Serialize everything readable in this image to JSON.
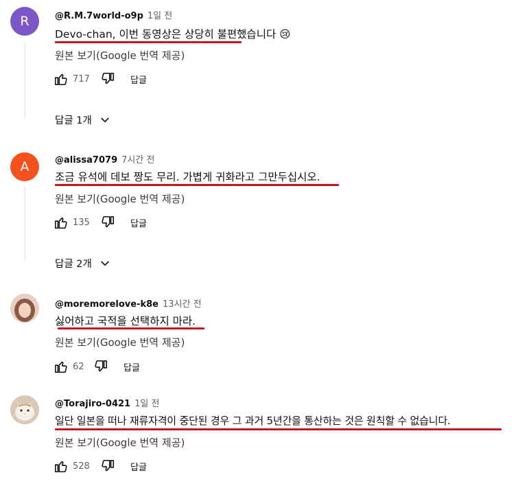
{
  "comments": [
    {
      "avatar_letter": "R",
      "avatar_color": "#7b57c8",
      "handle": "@R.M.7world-o9p",
      "time": "1일 전",
      "text": "Devo-chan, 이번 동영상은 상당히 불편했습니다 😢",
      "translate": "원본 보기(Google 번역 제공)",
      "likes": "717",
      "reply_label": "답글",
      "replies_toggle": "답글 1개"
    },
    {
      "avatar_letter": "A",
      "avatar_color": "#f4511e",
      "handle": "@alissa7079",
      "time": "7시간 전",
      "text": "조금 유석에 데보 짱도 무리. 가볍게 귀화라고 그만두십시오.",
      "translate": "원본 보기(Google 번역 제공)",
      "likes": "135",
      "reply_label": "답글",
      "replies_toggle": "답글 2개"
    },
    {
      "avatar_color": "#d9b8ad",
      "handle": "@moremorelove-k8e",
      "time": "13시간 전",
      "text": "싫어하고 국적을 선택하지 마라.",
      "translate": "원본 보기(Google 번역 제공)",
      "likes": "62",
      "reply_label": "답글"
    },
    {
      "avatar_color": "#c9b49a",
      "handle": "@Torajiro-0421",
      "time": "1일 전",
      "text": "일단 일본을 떠나 재류자격이 중단된 경우 그 과거 5년간을 통산하는 것은 원칙할 수 없습니다.",
      "translate": "원본 보기(Google 번역 제공)",
      "likes": "528",
      "reply_label": "답글"
    }
  ],
  "icons": {
    "like": "thumb-up-icon",
    "dislike": "thumb-down-icon",
    "expand": "chevron-down-icon"
  },
  "accent_color": "#c8141e"
}
